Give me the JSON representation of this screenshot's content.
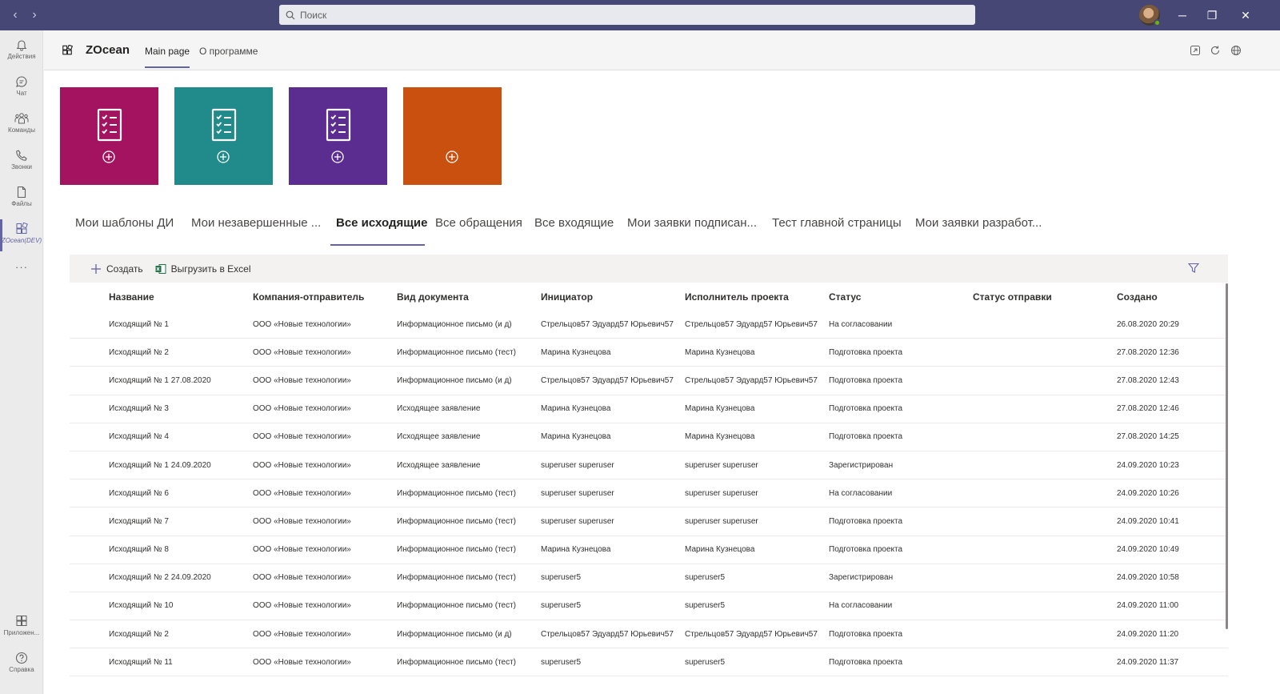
{
  "titlebar": {
    "search_placeholder": "Поиск",
    "back": "‹",
    "forward": "›",
    "minimize": "─",
    "restore": "❐",
    "close": "✕"
  },
  "rail": [
    {
      "label": "Действия",
      "icon": "bell-icon"
    },
    {
      "label": "Чат",
      "icon": "chat-icon"
    },
    {
      "label": "Команды",
      "icon": "teams-icon"
    },
    {
      "label": "Звонки",
      "icon": "phone-icon"
    },
    {
      "label": "Файлы",
      "icon": "file-icon"
    },
    {
      "label": "ZOcean(DEV)",
      "icon": "apps-icon"
    },
    {
      "label": "···",
      "icon": "more-icon"
    },
    {
      "label": "Приложен...",
      "icon": "store-icon"
    },
    {
      "label": "Справка",
      "icon": "help-icon"
    }
  ],
  "app": {
    "name": "ZOcean",
    "tabs": [
      "Main page",
      "О программе"
    ]
  },
  "tiles": [
    {
      "color": "#a4135f",
      "icon": "checklist-icon"
    },
    {
      "color": "#218a8a",
      "icon": "checklist-icon"
    },
    {
      "color": "#5c2d91",
      "icon": "checklist-icon"
    },
    {
      "color": "#ca5010",
      "icon": "plus-icon"
    }
  ],
  "view_tabs": [
    "Мои шаблоны ДИ",
    "Мои незавершенные ...",
    "Все исходящие",
    "Все обращения",
    "Все входящие",
    "Мои заявки подписан...",
    "Тест главной страницы",
    "Мои заявки разработ..."
  ],
  "toolbar": {
    "create_label": "Создать",
    "export_label": "Выгрузить в Excel"
  },
  "table": {
    "columns": [
      "Название",
      "Компания-отправитель",
      "Вид документа",
      "Инициатор",
      "Исполнитель проекта",
      "Статус",
      "Статус отправки",
      "Создано"
    ],
    "rows": [
      [
        "Исходящий № 1",
        "ООО «Новые технологии»",
        "Информационное письмо (и д)",
        "Стрельцов57 Эдуард57 Юрьевич57",
        "Стрельцов57 Эдуард57 Юрьевич57",
        "На согласовании",
        "",
        "26.08.2020 20:29"
      ],
      [
        "Исходящий № 2",
        "ООО «Новые технологии»",
        "Информационное письмо (тест)",
        "Марина Кузнецова",
        "Марина Кузнецова",
        "Подготовка проекта",
        "",
        "27.08.2020 12:36"
      ],
      [
        "Исходящий № 1 27.08.2020",
        "ООО «Новые технологии»",
        "Информационное письмо (и д)",
        "Стрельцов57 Эдуард57 Юрьевич57",
        "Стрельцов57 Эдуард57 Юрьевич57",
        "Подготовка проекта",
        "",
        "27.08.2020 12:43"
      ],
      [
        "Исходящий № 3",
        "ООО «Новые технологии»",
        "Исходящее заявление",
        "Марина Кузнецова",
        "Марина Кузнецова",
        "Подготовка проекта",
        "",
        "27.08.2020 12:46"
      ],
      [
        "Исходящий № 4",
        "ООО «Новые технологии»",
        "Исходящее заявление",
        "Марина Кузнецова",
        "Марина Кузнецова",
        "Подготовка проекта",
        "",
        "27.08.2020 14:25"
      ],
      [
        "Исходящий № 1 24.09.2020",
        "ООО «Новые технологии»",
        "Исходящее заявление",
        "superuser superuser",
        "superuser superuser",
        "Зарегистрирован",
        "",
        "24.09.2020 10:23"
      ],
      [
        "Исходящий № 6",
        "ООО «Новые технологии»",
        "Информационное письмо (тест)",
        "superuser superuser",
        "superuser superuser",
        "На согласовании",
        "",
        "24.09.2020 10:26"
      ],
      [
        "Исходящий № 7",
        "ООО «Новые технологии»",
        "Информационное письмо (тест)",
        "superuser superuser",
        "superuser superuser",
        "Подготовка проекта",
        "",
        "24.09.2020 10:41"
      ],
      [
        "Исходящий № 8",
        "ООО «Новые технологии»",
        "Информационное письмо (тест)",
        "Марина Кузнецова",
        "Марина Кузнецова",
        "Подготовка проекта",
        "",
        "24.09.2020 10:49"
      ],
      [
        "Исходящий № 2 24.09.2020",
        "ООО «Новые технологии»",
        "Информационное письмо (тест)",
        "superuser5",
        "superuser5",
        "Зарегистрирован",
        "",
        "24.09.2020 10:58"
      ],
      [
        "Исходящий № 10",
        "ООО «Новые технологии»",
        "Информационное письмо (тест)",
        "superuser5",
        "superuser5",
        "На согласовании",
        "",
        "24.09.2020 11:00"
      ],
      [
        "Исходящий № 2",
        "ООО «Новые технологии»",
        "Информационное письмо (и д)",
        "Стрельцов57 Эдуард57 Юрьевич57",
        "Стрельцов57 Эдуард57 Юрьевич57",
        "Подготовка проекта",
        "",
        "24.09.2020 11:20"
      ],
      [
        "Исходящий № 11",
        "ООО «Новые технологии»",
        "Информационное письмо (тест)",
        "superuser5",
        "superuser5",
        "Подготовка проекта",
        "",
        "24.09.2020 11:37"
      ]
    ]
  },
  "colors": {
    "titlebar": "#464775",
    "accent": "#6264a7"
  }
}
